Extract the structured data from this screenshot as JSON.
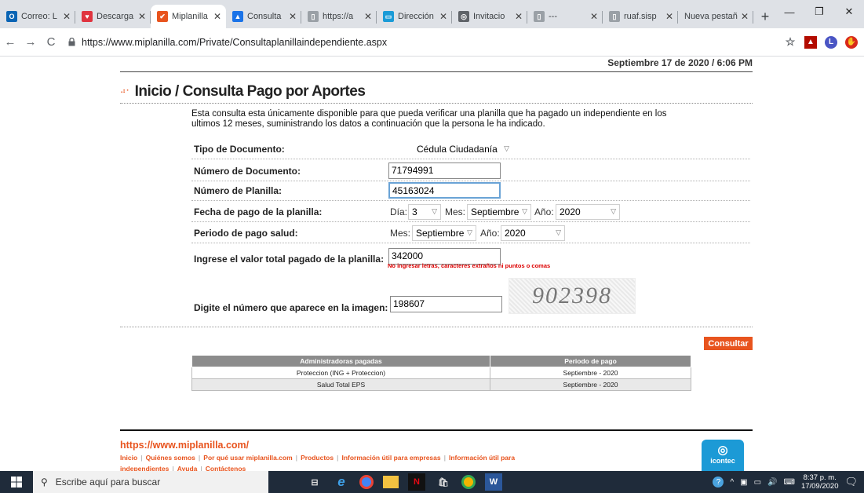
{
  "browser": {
    "tabs": [
      {
        "title": "Correo: L",
        "favicon_color": "#0a64b4",
        "favicon_glyph": "O"
      },
      {
        "title": "Descarga",
        "favicon_color": "#e0343f",
        "favicon_glyph": "♥"
      },
      {
        "title": "Miplanilla",
        "favicon_color": "#e8541e",
        "favicon_glyph": "✔",
        "active": true
      },
      {
        "title": "Consulta",
        "favicon_color": "#1a73e8",
        "favicon_glyph": "▲"
      },
      {
        "title": "https://a",
        "favicon_color": "#9aa0a6",
        "favicon_glyph": "▯"
      },
      {
        "title": "Dirección",
        "favicon_color": "#1a9bd7",
        "favicon_glyph": "▭"
      },
      {
        "title": "Invitacio",
        "favicon_color": "#5f6368",
        "favicon_glyph": "◎"
      },
      {
        "title": "---",
        "favicon_color": "#9aa0a6",
        "favicon_glyph": "▯"
      },
      {
        "title": "ruaf.sisp",
        "favicon_color": "#9aa0a6",
        "favicon_glyph": "▯"
      },
      {
        "title": "Nueva pestañ",
        "favicon_color": "",
        "favicon_glyph": ""
      }
    ],
    "url": "https://www.miplanilla.com/Private/Consultaplanillaindependiente.aspx",
    "profile_initial": "L"
  },
  "page": {
    "date": "Septiembre 17 de 2020 / 6:06 PM",
    "title_inicio": "Inicio",
    "title_sep": " / ",
    "title_main": "Consulta Pago por Aportes",
    "intro": "Esta consulta esta únicamente disponible para que pueda verificar una planilla que ha pagado un independiente en los ultimos 12 meses, suministrando los datos a continuación que la persona le ha indicado.",
    "form": {
      "tipo_label": "Tipo de Documento:",
      "tipo_value": "Cédula Ciudadanía",
      "numero_doc_label": "Número de Documento:",
      "numero_doc_value": "71794991",
      "numero_planilla_label": "Número de Planilla:",
      "numero_planilla_value": "45163024",
      "fecha_label": "Fecha de pago de la planilla:",
      "dia_label": "Día:",
      "dia_value": "3",
      "mes_label": "Mes:",
      "mes_value": "Septiembre",
      "anio_label": "Año:",
      "anio_value": "2020",
      "periodo_label": "Periodo de pago salud:",
      "periodo_mes_label": "Mes:",
      "periodo_mes_value": "Septiembre",
      "periodo_anio_label": "Año:",
      "periodo_anio_value": "2020",
      "valor_label": "Ingrese el valor total pagado de la planilla:",
      "valor_value": "342000",
      "valor_warning": "No ingresar letras, caracteres extraños ni puntos o comas",
      "captcha_label": "Digite el número que aparece en la imagen:",
      "captcha_value": "198607",
      "captcha_image_text": "902398",
      "submit_label": "Consultar"
    },
    "results": {
      "headers": [
        "Administradoras pagadas",
        "Periodo de pago"
      ],
      "rows": [
        [
          "Proteccion (ING + Proteccion)",
          "Septiembre - 2020"
        ],
        [
          "Salud Total EPS",
          "Septiembre - 2020"
        ]
      ]
    },
    "footer": {
      "url": "https://www.miplanilla.com/",
      "links": [
        "Inicio",
        "Quiénes somos",
        "Por qué usar miplanilla.com",
        "Productos",
        "Información útil para empresas",
        "Información útil para independientes",
        "Ayuda",
        "Contáctenos"
      ],
      "badge": "icontec"
    }
  },
  "taskbar": {
    "search_placeholder": "Escribe aquí para buscar",
    "time": "8:37 p. m.",
    "date": "17/09/2020"
  }
}
